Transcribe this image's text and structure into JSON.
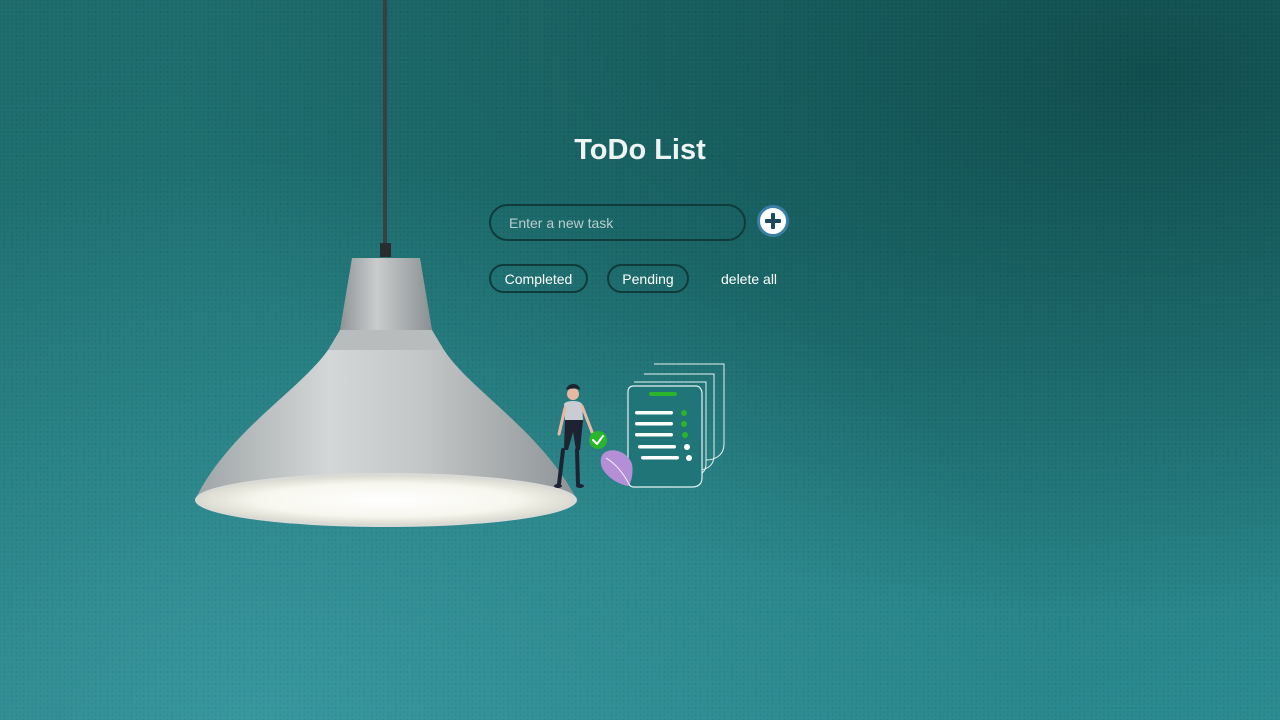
{
  "app": {
    "title": "ToDo List"
  },
  "task_input": {
    "value": "",
    "placeholder": "Enter a new task"
  },
  "add_button": {
    "icon": "plus-circle-icon"
  },
  "filters": {
    "completed_label": "Completed",
    "pending_label": "Pending",
    "delete_all_label": "delete all"
  },
  "colors": {
    "background": "#1f7577",
    "input_border": "#0f3b3b",
    "add_button_ring": "#3a7fa3",
    "accent_green": "#2bb52b",
    "figure_leaf": "#b48fd6"
  },
  "illustration": {
    "icon": "empty-list-illustration"
  }
}
